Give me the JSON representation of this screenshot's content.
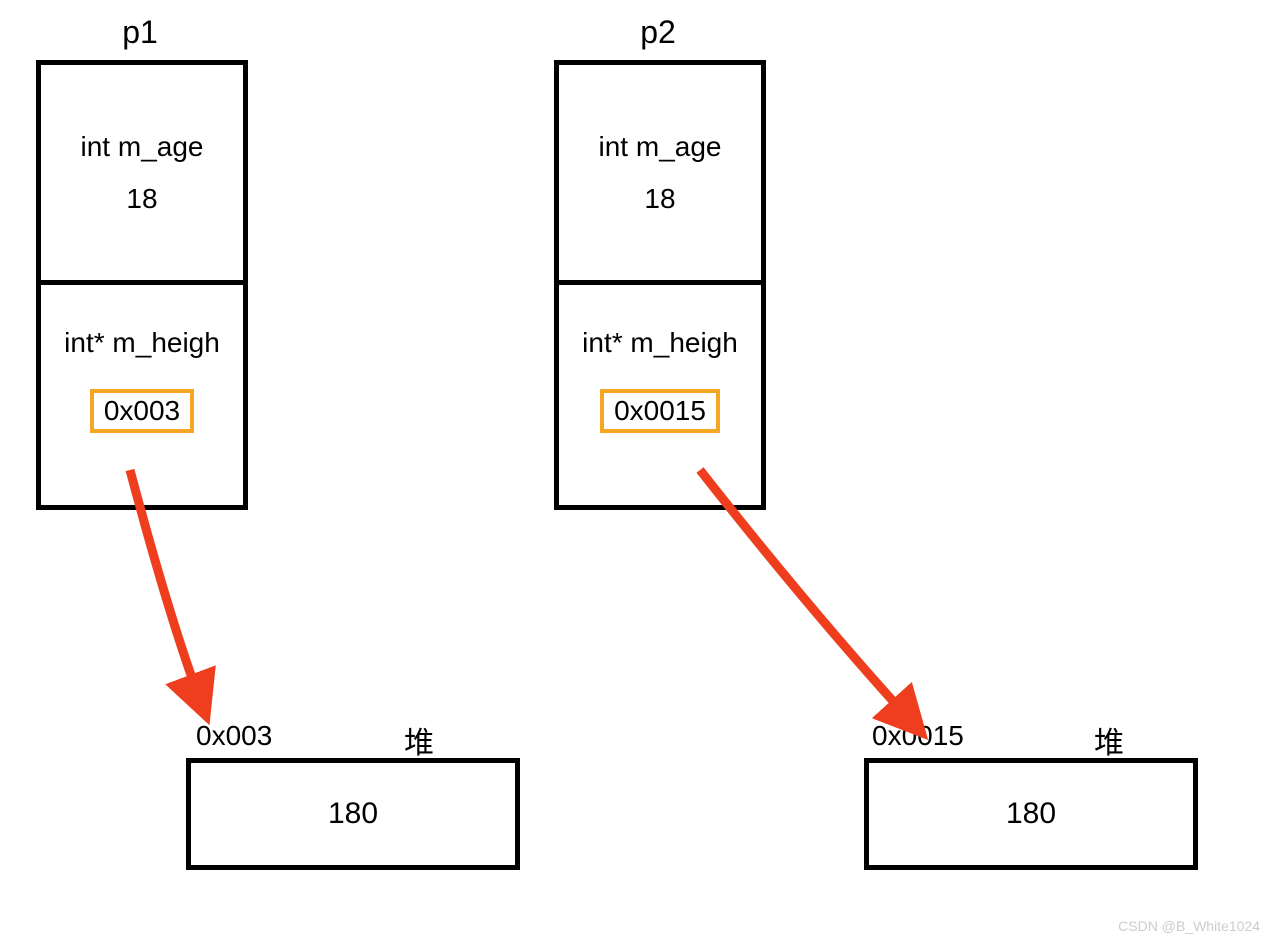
{
  "p1": {
    "label": "p1",
    "field1": "int m_age",
    "value1": "18",
    "field2": "int* m_heigh",
    "addr": "0x003"
  },
  "p2": {
    "label": "p2",
    "field1": "int m_age",
    "value1": "18",
    "field2": "int* m_heigh",
    "addr": "0x0015"
  },
  "heap1": {
    "label": "堆",
    "addr": "0x003",
    "value": "180"
  },
  "heap2": {
    "label": "堆",
    "addr": "0x0015",
    "value": "180"
  },
  "watermark": "CSDN @B_White1024"
}
